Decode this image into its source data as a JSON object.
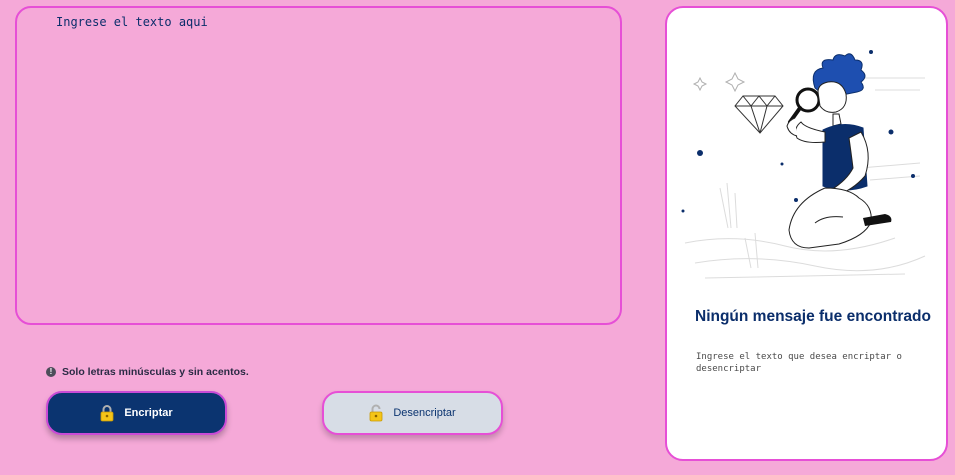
{
  "input": {
    "placeholder": "Ingrese el texto aqui"
  },
  "hint": {
    "icon": "info-icon",
    "text": "Solo letras minúsculas y sin acentos."
  },
  "buttons": {
    "encrypt": {
      "label": "Encriptar",
      "icon": "lock-closed-icon"
    },
    "decrypt": {
      "label": "Desencriptar",
      "icon": "lock-open-icon"
    }
  },
  "output": {
    "title": "Ningún mensaje fue encontrado",
    "description": "Ingrese el texto que desea encriptar o desencriptar"
  },
  "colors": {
    "background": "#f5a9d8",
    "border": "#e64fd6",
    "primary": "#0b3470",
    "secondary_button": "#d7dde6",
    "panel": "#ffffff"
  }
}
